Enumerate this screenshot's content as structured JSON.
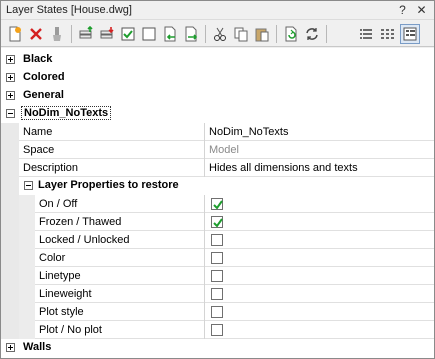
{
  "window": {
    "title": "Layer States [House.dwg]",
    "help_glyph": "?",
    "close_glyph": "✕"
  },
  "toolbar": {
    "buttons": [
      {
        "name": "new-layer-state-icon"
      },
      {
        "name": "delete-icon"
      },
      {
        "name": "brush-icon"
      },
      {
        "name": "layers-up-icon"
      },
      {
        "name": "layers-down-icon"
      },
      {
        "name": "checkbox-icon"
      },
      {
        "name": "blank-page-icon"
      },
      {
        "name": "import-icon"
      },
      {
        "name": "export-icon"
      },
      {
        "name": "cut-icon"
      },
      {
        "name": "copy-icon"
      },
      {
        "name": "paste-icon"
      },
      {
        "name": "restore-icon"
      },
      {
        "name": "refresh-icon"
      },
      {
        "name": "list-view-icon"
      },
      {
        "name": "tile-view-icon"
      },
      {
        "name": "properties-view-icon"
      }
    ]
  },
  "groups": [
    {
      "label": "Black",
      "expanded": false
    },
    {
      "label": "Colored",
      "expanded": false
    },
    {
      "label": "General",
      "expanded": false
    },
    {
      "label": "NoDim_NoTexts",
      "expanded": true
    },
    {
      "label": "Walls",
      "expanded": false
    }
  ],
  "properties": [
    {
      "name": "Name",
      "value": "NoDim_NoTexts",
      "muted": false
    },
    {
      "name": "Space",
      "value": "Model",
      "muted": true
    },
    {
      "name": "Description",
      "value": "Hides all dimensions and texts",
      "muted": false
    }
  ],
  "restore_section": {
    "label": "Layer Properties to restore",
    "items": [
      {
        "name": "On / Off",
        "checked": true
      },
      {
        "name": "Frozen / Thawed",
        "checked": true
      },
      {
        "name": "Locked / Unlocked",
        "checked": false
      },
      {
        "name": "Color",
        "checked": false
      },
      {
        "name": "Linetype",
        "checked": false
      },
      {
        "name": "Lineweight",
        "checked": false
      },
      {
        "name": "Plot style",
        "checked": false
      },
      {
        "name": "Plot / No plot",
        "checked": false
      }
    ]
  },
  "colors": {
    "check": "#1e9e2e",
    "selection_border": "#7a9cc6"
  }
}
